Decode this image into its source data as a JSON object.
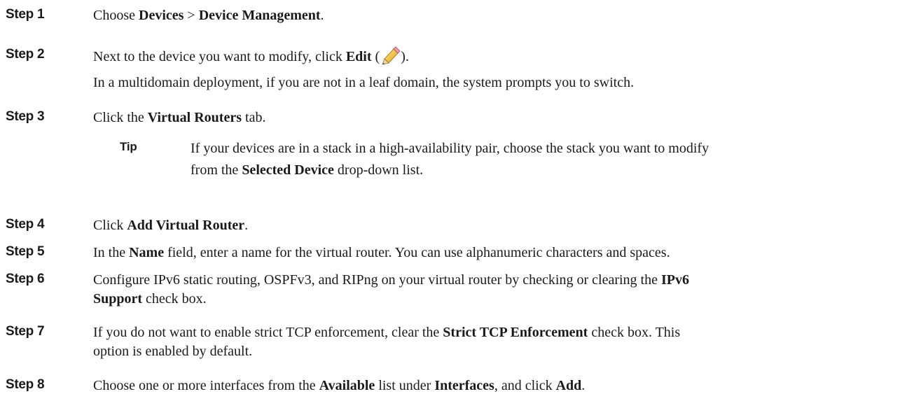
{
  "steps": [
    {
      "label": "Step 1",
      "text_1": "Choose ",
      "b_1": "Devices",
      "text_2": " > ",
      "b_2": "Device Management",
      "text_3": "."
    },
    {
      "label": "Step 2",
      "text_1": "Next to the device you want to modify, click ",
      "b_1": "Edit",
      "text_2": " (",
      "icon": "pencil-icon",
      "text_3": ").",
      "note": "In a multidomain deployment, if you are not in a leaf domain, the system prompts you to switch."
    },
    {
      "label": "Step 3",
      "text_1": "Click the ",
      "b_1": "Virtual Routers",
      "text_2": " tab.",
      "tip": {
        "label": "Tip",
        "line_1": "If your devices are in a stack in a high-availability pair, choose the stack you want to modify",
        "line_2_prefix": "from the ",
        "line_2_bold": "Selected Device",
        "line_2_suffix": " drop-down list."
      }
    },
    {
      "label": "Step 4",
      "text_1": "Click ",
      "b_1": "Add Virtual Router",
      "text_2": "."
    },
    {
      "label": "Step 5",
      "text_1": "In the ",
      "b_1": "Name",
      "text_2": " field, enter a name for the virtual router. You can use alphanumeric characters and spaces."
    },
    {
      "label": "Step 6",
      "line_1_text": "Configure IPv6 static routing, OSPFv3, and RIPng on your virtual router by checking or clearing the ",
      "line_1_bold": "IPv6",
      "line_2_bold": "Support",
      "line_2_text": " check box."
    },
    {
      "label": "Step 7",
      "line_1_text": "If you do not want to enable strict TCP enforcement, clear the ",
      "line_1_bold": "Strict TCP Enforcement",
      "line_1_suffix": " check box. This",
      "line_2_text": "option is enabled by default."
    },
    {
      "label": "Step 8",
      "text_1": "Choose one or more interfaces from the ",
      "b_1": "Available",
      "text_2": " list under ",
      "b_2": "Interfaces",
      "text_3": ", and click ",
      "b_3": "Add",
      "text_4": "."
    }
  ]
}
